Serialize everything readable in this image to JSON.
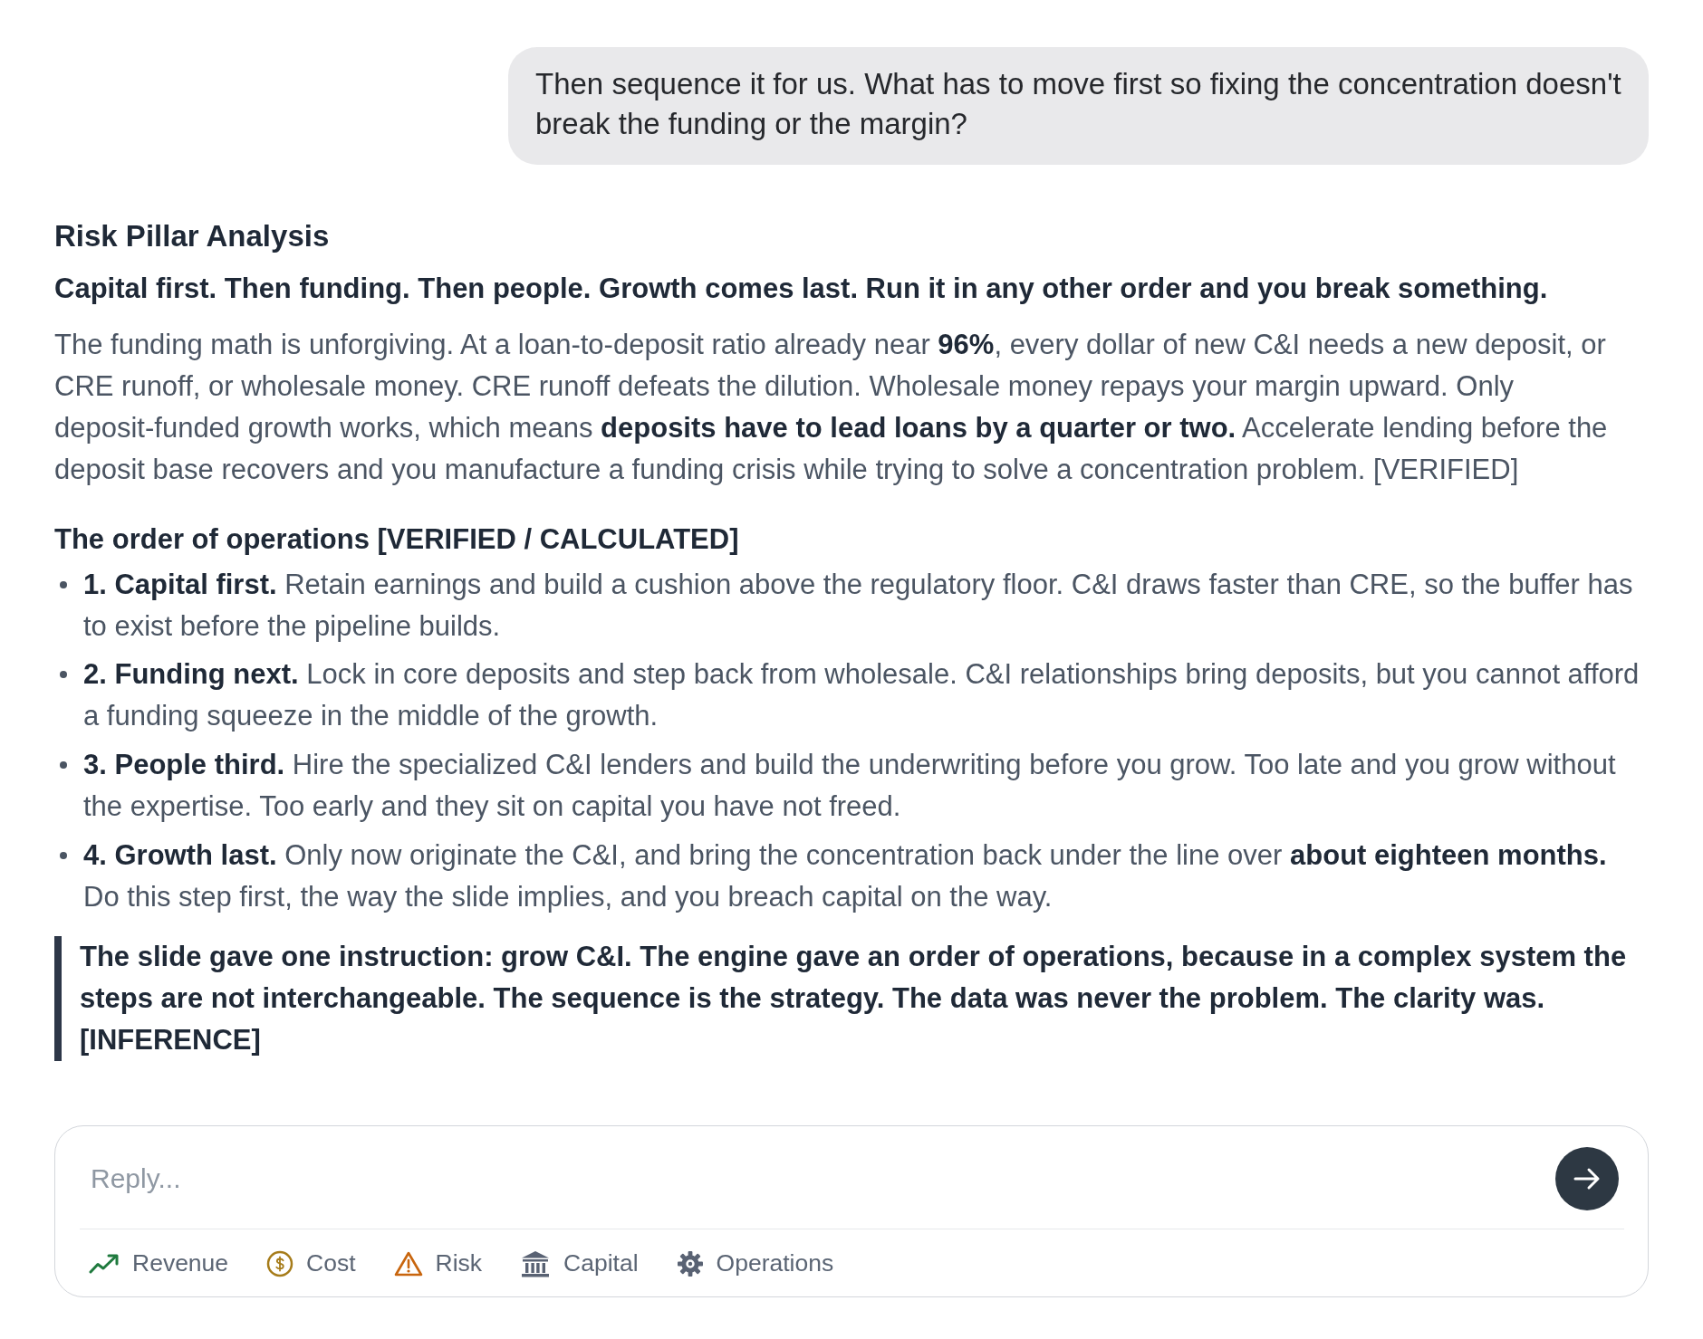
{
  "user_message": {
    "text": "Then sequence it for us. What has to move first so fixing the concentration doesn't break the funding or the margin?"
  },
  "response": {
    "title": "Risk Pillar Analysis",
    "lead": "Capital first. Then funding. Then people. Growth comes last. Run it in any other order and you break something.",
    "paragraph": "The funding math is unforgiving. At a loan-to-deposit ratio already near **96%**, every dollar of new C&I needs a new deposit, or CRE runoff, or wholesale money. CRE runoff defeats the dilution. Wholesale money repays your margin upward. Only deposit-funded growth works, which means **deposits have to lead loans by a quarter or two.** Accelerate lending before the deposit base recovers and you manufacture a funding crisis while trying to solve a concentration problem. [VERIFIED]",
    "section_heading": "The order of operations [VERIFIED / CALCULATED]",
    "steps": [
      {
        "text": "**1. Capital first.** Retain earnings and build a cushion above the regulatory floor. C&I draws faster than CRE, so the buffer has to exist before the pipeline builds."
      },
      {
        "text": "**2. Funding next.** Lock in core deposits and step back from wholesale. C&I relationships bring deposits, but you cannot afford a funding squeeze in the middle of the growth."
      },
      {
        "text": "**3. People third.** Hire the specialized C&I lenders and build the underwriting before you grow. Too late and you grow without the expertise. Too early and they sit on capital you have not freed."
      },
      {
        "text": "**4. Growth last.** Only now originate the C&I, and bring the concentration back under the line over **about eighteen months.** Do this step first, the way the slide implies, and you breach capital on the way."
      }
    ],
    "callout": "The slide gave one instruction: grow C&I. The engine gave an order of operations, because in a complex system the steps are not interchangeable. The sequence is the strategy. The data was never the problem. The clarity was. [INFERENCE]"
  },
  "composer": {
    "placeholder": "Reply...",
    "pillars": [
      {
        "label": "Revenue",
        "kind": "revenue",
        "color": "#1f7a3e"
      },
      {
        "label": "Cost",
        "kind": "cost",
        "color": "#a67c1a"
      },
      {
        "label": "Risk",
        "kind": "risk",
        "color": "#c8650d"
      },
      {
        "label": "Capital",
        "kind": "capital",
        "color": "#596273"
      },
      {
        "label": "Operations",
        "kind": "operations",
        "color": "#596273"
      }
    ]
  }
}
